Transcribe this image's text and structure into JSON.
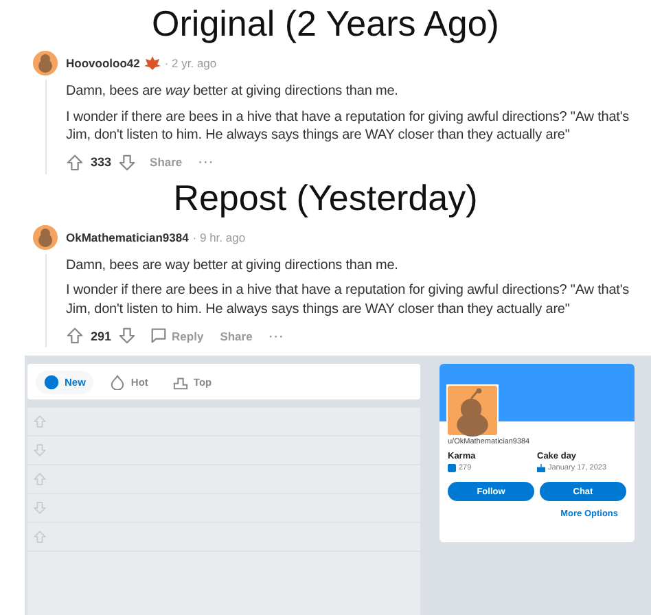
{
  "sections": [
    {
      "heading": "Original (2 Years Ago)",
      "comment": {
        "username": "Hoovooloo42",
        "has_award": true,
        "time": "· 2 yr. ago",
        "paragraphs": [
          "Damn, bees are *way* better at giving directions than me.",
          "I wonder if there are bees in a hive that have a reputation for giving awful directions? \"Aw that's Jim, don't listen to him. He always says things are WAY closer than they actually are\""
        ],
        "score": "333",
        "actions": [
          {
            "kind": "share",
            "label": "Share"
          },
          {
            "kind": "more",
            "label": "···"
          }
        ]
      }
    },
    {
      "heading": "Repost (Yesterday)",
      "comment": {
        "username": "OkMathematician9384",
        "has_award": false,
        "time": "· 9 hr. ago",
        "paragraphs": [
          "Damn, bees are way better at giving directions than me.",
          "I wonder if there are bees in a hive that have a reputation for giving awful directions? \"Aw that's Jim, don't listen to him. He always says things are WAY closer than they actually are\""
        ],
        "score": "291",
        "actions": [
          {
            "kind": "reply",
            "label": "Reply"
          },
          {
            "kind": "share",
            "label": "Share"
          },
          {
            "kind": "more",
            "label": "···"
          }
        ]
      }
    }
  ],
  "profile_page": {
    "sort_tabs": [
      {
        "kind": "new",
        "label": "New",
        "selected": true
      },
      {
        "kind": "hot",
        "label": "Hot",
        "selected": false
      },
      {
        "kind": "top",
        "label": "Top",
        "selected": false
      }
    ],
    "vote_placeholders": [
      {
        "kind": "up"
      },
      {
        "kind": "down"
      },
      {
        "kind": "up"
      },
      {
        "kind": "down"
      },
      {
        "kind": "up"
      }
    ],
    "profile_card": {
      "username": "u/OkMathematician9384",
      "karma_label": "Karma",
      "karma": "279",
      "cake_day_label": "Cake day",
      "cake_day": "January 17, 2023",
      "buttons": [
        "Follow",
        "Chat"
      ],
      "link": "More Options"
    }
  }
}
